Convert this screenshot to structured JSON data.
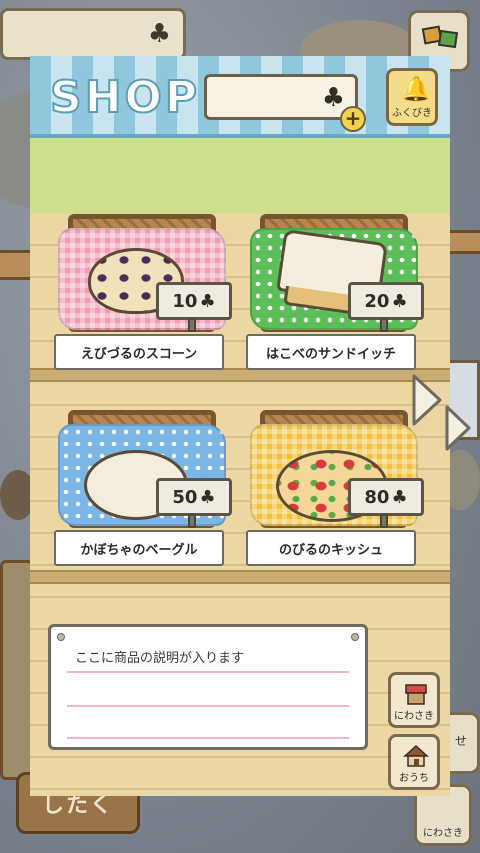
{
  "header": {
    "title": "SHOP",
    "clover_icon": "clover-icon",
    "add_icon": "plus-icon",
    "fukubiki_label": "ふくびき"
  },
  "items": [
    {
      "name": "えびづるのスコーン",
      "price": "10",
      "cloth_color": "#f29bb3",
      "food": "scone"
    },
    {
      "name": "はこべのサンドイッチ",
      "price": "20",
      "cloth_color": "#5cbf5a",
      "food": "sandwich"
    },
    {
      "name": "かぼちゃのベーグル",
      "price": "50",
      "cloth_color": "#7ab7e6",
      "food": "bagel"
    },
    {
      "name": "のびるのキッシュ",
      "price": "80",
      "cloth_color": "#f2c13c",
      "food": "quiche"
    }
  ],
  "price_icon": "♣",
  "description": {
    "text": "ここに商品の説明が入ります"
  },
  "side_buttons": {
    "niwasaki_label": "にわさき",
    "ouchi_label": "おうち"
  },
  "background": {
    "bottom_button_label": "したく",
    "right_bottom_label": "にわさき",
    "right_partial_label": "せ"
  }
}
